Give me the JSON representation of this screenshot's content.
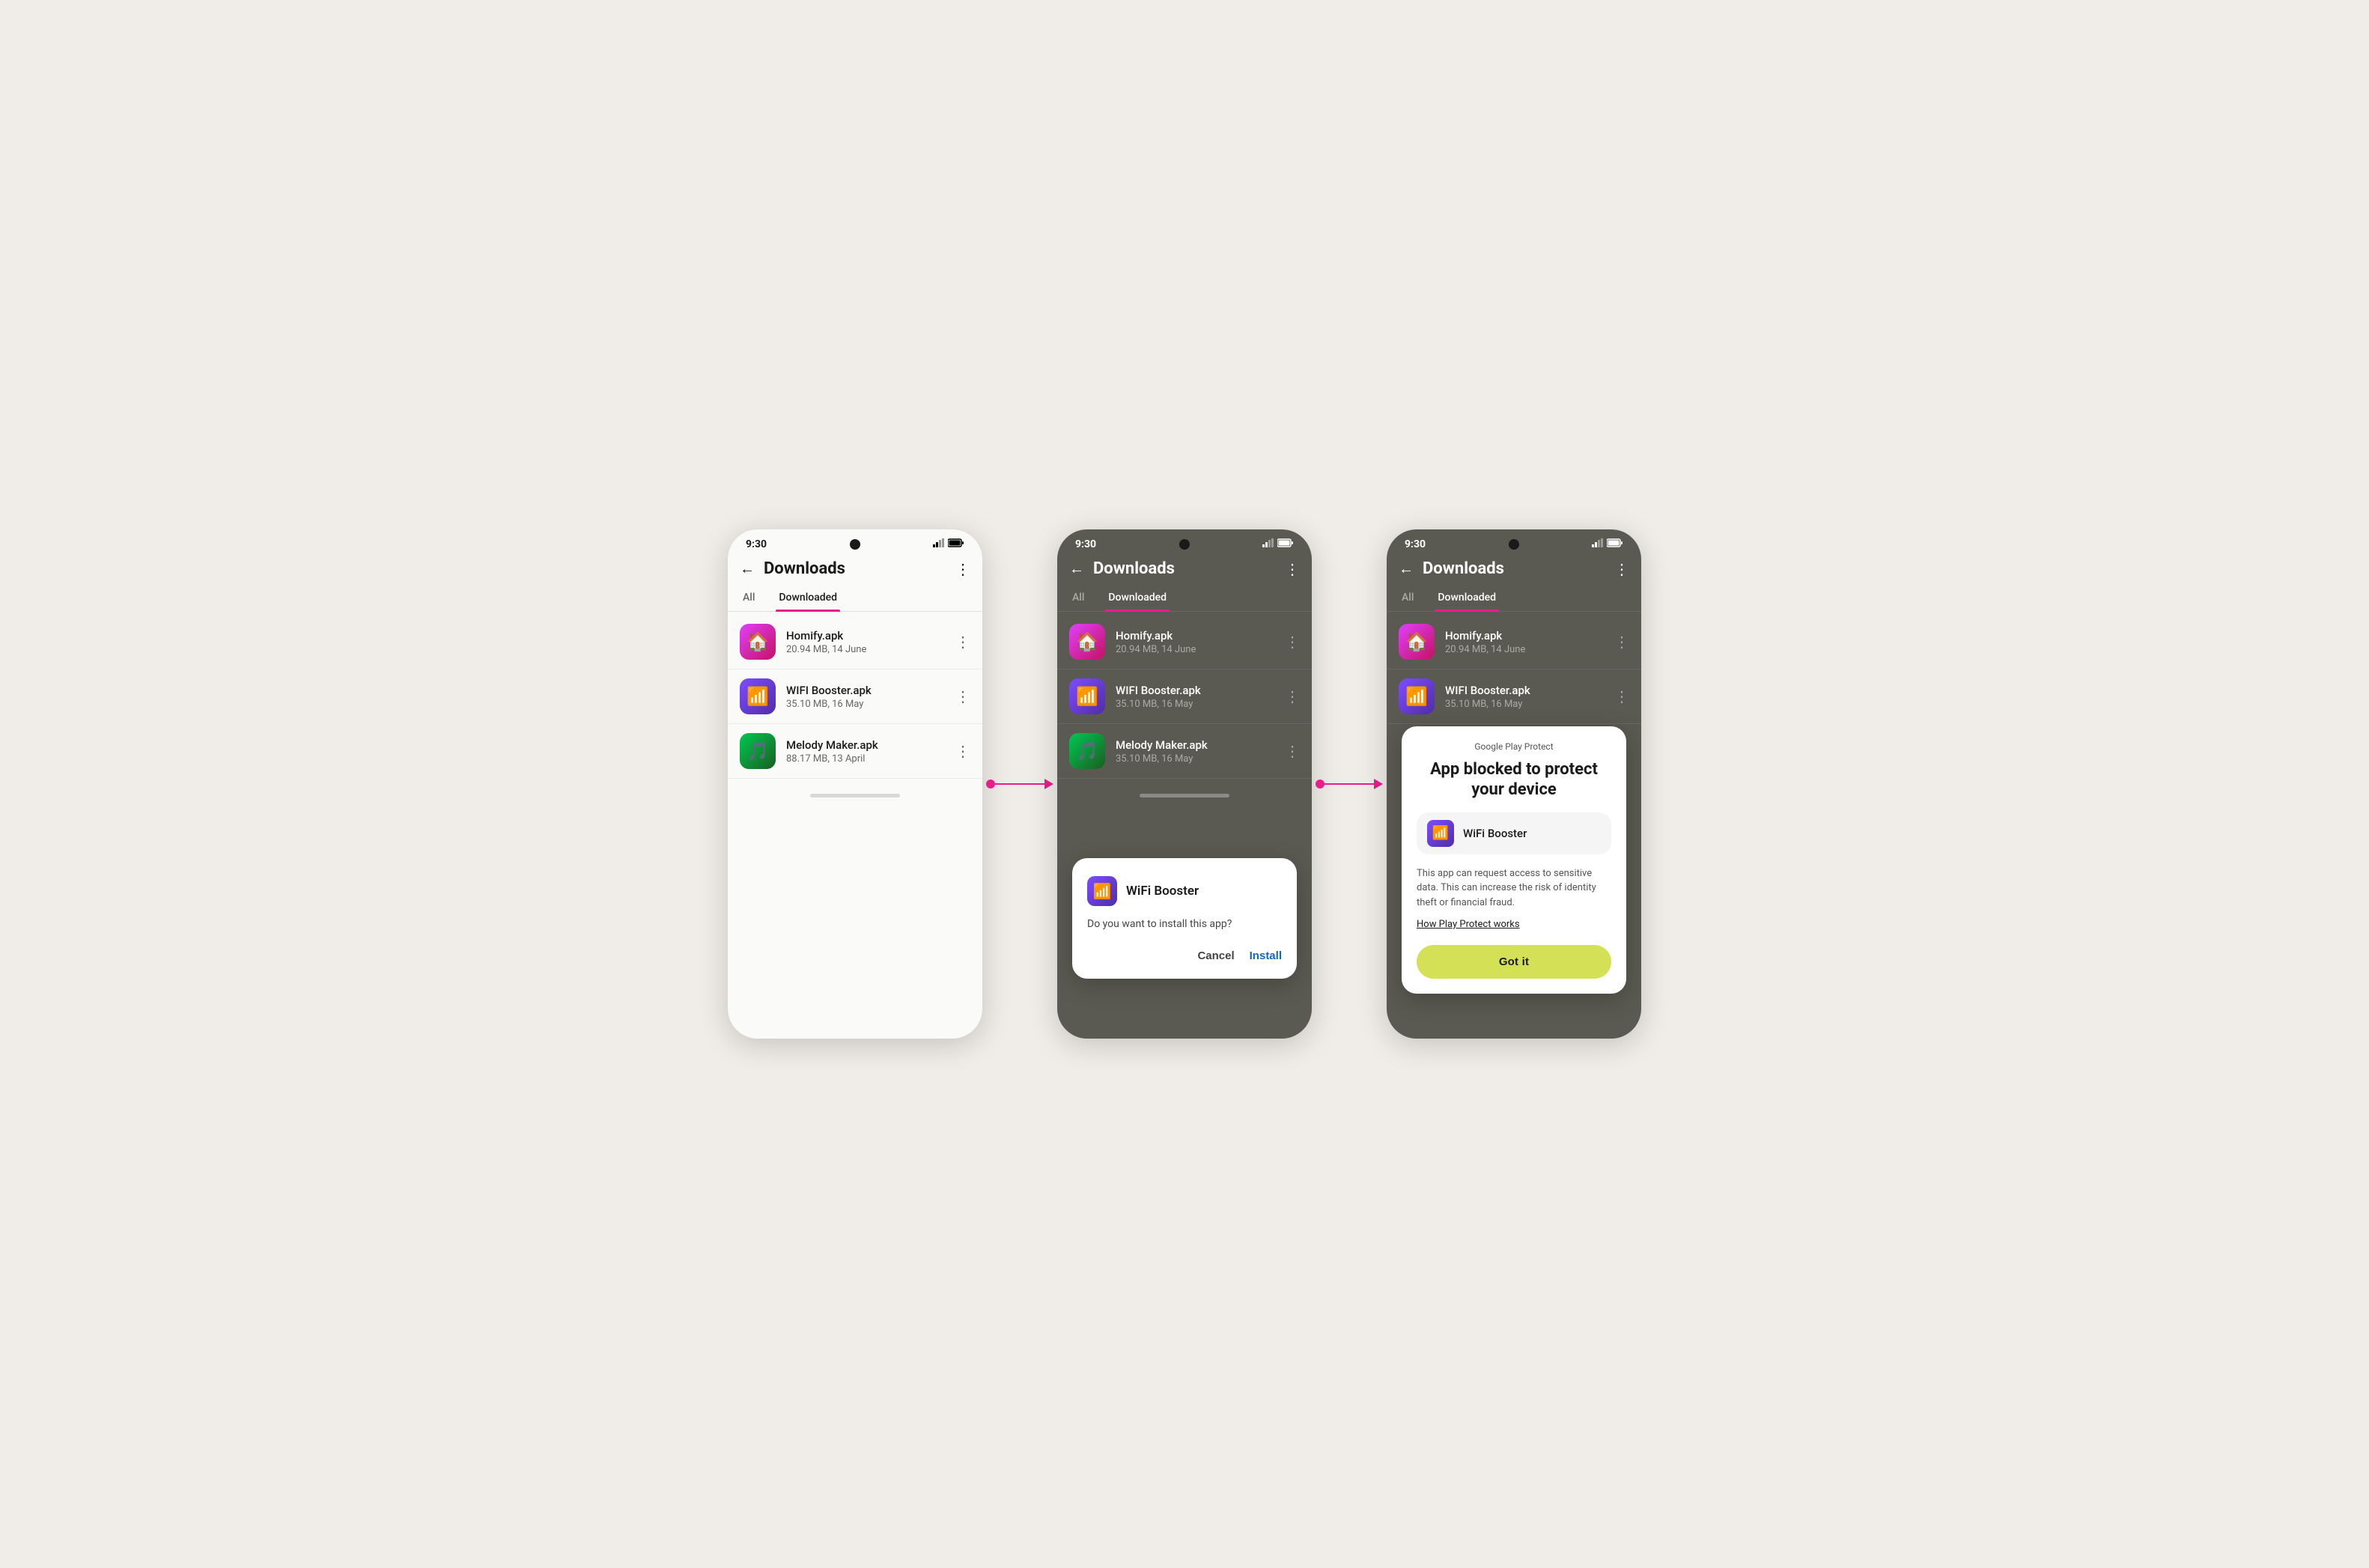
{
  "phones": [
    {
      "id": "phone1",
      "theme": "light",
      "statusBar": {
        "time": "9:30",
        "showCamera": true
      },
      "appBar": {
        "title": "Downloads",
        "showBack": true,
        "showMore": true
      },
      "tabs": [
        {
          "label": "All",
          "active": false
        },
        {
          "label": "Downloaded",
          "active": true
        }
      ],
      "items": [
        {
          "name": "Homify.apk",
          "meta": "20.94 MB, 14 June",
          "icon": "homify",
          "iconEmoji": "🏠"
        },
        {
          "name": "WIFI Booster.apk",
          "meta": "35.10 MB, 16 May",
          "icon": "wifi",
          "iconEmoji": "📶"
        },
        {
          "name": "Melody Maker.apk",
          "meta": "88.17 MB, 13 April",
          "icon": "melody",
          "iconEmoji": "🎵"
        }
      ]
    },
    {
      "id": "phone2",
      "theme": "dark",
      "statusBar": {
        "time": "9:30",
        "showCamera": true
      },
      "appBar": {
        "title": "Downloads",
        "showBack": true,
        "showMore": true
      },
      "tabs": [
        {
          "label": "All",
          "active": false
        },
        {
          "label": "Downloaded",
          "active": true
        }
      ],
      "items": [
        {
          "name": "Homify.apk",
          "meta": "20.94 MB, 14 June",
          "icon": "homify",
          "iconEmoji": "🏠"
        },
        {
          "name": "WIFI Booster.apk",
          "meta": "35.10 MB, 16 May",
          "icon": "wifi",
          "iconEmoji": "📶"
        },
        {
          "name": "Melody Maker.apk",
          "meta": "35.10 MB, 16 May",
          "icon": "melody",
          "iconEmoji": "🎵"
        }
      ],
      "dialog": {
        "appName": "WiFi Booster",
        "question": "Do you want to install this app?",
        "cancelLabel": "Cancel",
        "installLabel": "Install"
      }
    },
    {
      "id": "phone3",
      "theme": "dark",
      "statusBar": {
        "time": "9:30",
        "showCamera": true
      },
      "appBar": {
        "title": "Downloads",
        "showBack": true,
        "showMore": true
      },
      "tabs": [
        {
          "label": "All",
          "active": false
        },
        {
          "label": "Downloaded",
          "active": true
        }
      ],
      "items": [
        {
          "name": "Homify.apk",
          "meta": "20.94 MB, 14 June",
          "icon": "homify",
          "iconEmoji": "🏠"
        },
        {
          "name": "WIFI Booster.apk",
          "meta": "35.10 MB, 16 May",
          "icon": "wifi",
          "iconEmoji": "📶"
        }
      ],
      "protectDialog": {
        "header": "Google Play Protect",
        "title": "App blocked to protect your device",
        "appName": "WiFi Booster",
        "body": "This app can request access to sensitive data. This can increase the risk of identity theft or financial fraud.",
        "linkText": "How Play Protect works",
        "buttonLabel": "Got it"
      }
    }
  ],
  "arrows": [
    {
      "id": "arrow1"
    },
    {
      "id": "arrow2"
    }
  ]
}
